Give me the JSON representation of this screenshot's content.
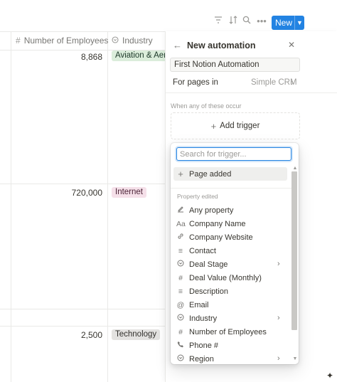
{
  "toolbar": {
    "icons": [
      "filter-icon",
      "sort-icon",
      "search-icon",
      "more-icon"
    ],
    "new_label": "New"
  },
  "table": {
    "columns": [
      {
        "label": "Number of Employees",
        "icon": "hash-icon"
      },
      {
        "label": "Industry",
        "icon": "select-icon"
      }
    ],
    "rows": [
      {
        "employees": "8,868",
        "industry": "Aviation & Aerospace",
        "industry_color": "#dbeddb",
        "industry_text": "#1c3829"
      },
      {
        "employees": "720,000",
        "industry": "Internet",
        "industry_color": "#f5e0e9",
        "industry_text": "#4c2337"
      },
      {
        "employees": "2,500",
        "industry": "Technology",
        "industry_color": "#e3e2e0",
        "industry_text": "#32302c"
      }
    ]
  },
  "panel": {
    "title": "New automation",
    "name_value": "First Notion Automation",
    "for_pages_label": "For pages in",
    "for_pages_value": "Simple CRM",
    "when_label": "When any of these occur",
    "add_trigger_label": "Add trigger"
  },
  "dropdown": {
    "search_placeholder": "Search for trigger...",
    "page_added_label": "Page added",
    "section_label": "Property edited",
    "items": [
      {
        "label": "Any property",
        "icon": "edit-icon"
      },
      {
        "label": "Company Name",
        "icon": "text-icon"
      },
      {
        "label": "Company Website",
        "icon": "link-icon"
      },
      {
        "label": "Contact",
        "icon": "lines-icon"
      },
      {
        "label": "Deal Stage",
        "icon": "select-icon",
        "submenu": true
      },
      {
        "label": "Deal Value (Monthly)",
        "icon": "hash-icon"
      },
      {
        "label": "Description",
        "icon": "lines-icon"
      },
      {
        "label": "Email",
        "icon": "at-icon"
      },
      {
        "label": "Industry",
        "icon": "select-icon",
        "submenu": true
      },
      {
        "label": "Number of Employees",
        "icon": "hash-icon"
      },
      {
        "label": "Phone #",
        "icon": "phone-icon"
      },
      {
        "label": "Region",
        "icon": "select-icon",
        "submenu": true
      }
    ]
  },
  "colors": {
    "accent": "#2383e2",
    "text": "#37352f",
    "muted": "#9b9a97",
    "border": "#e9e9e7"
  }
}
